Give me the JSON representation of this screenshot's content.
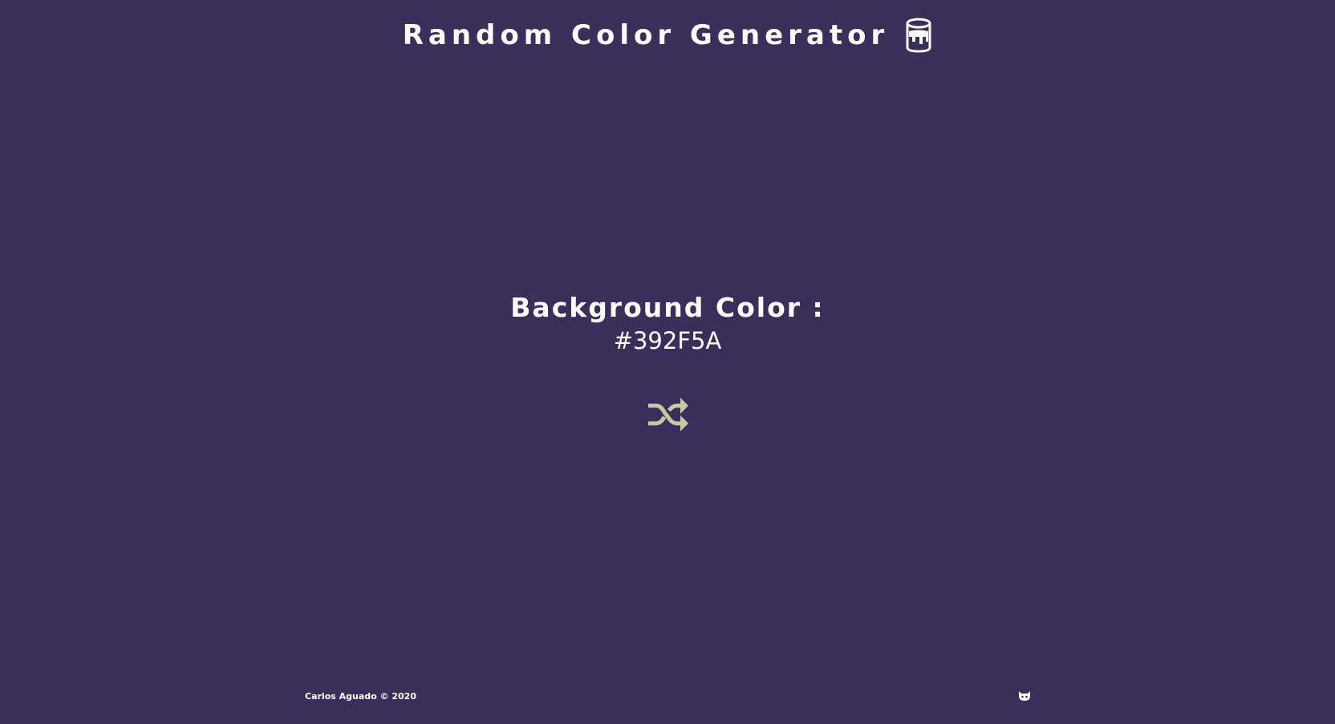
{
  "header": {
    "title": "Random Color Generator",
    "icon": "paint-bucket-icon"
  },
  "main": {
    "label": "Background Color :",
    "value": "#392F5A",
    "shuffle_icon": "shuffle-icon"
  },
  "footer": {
    "credit": "Carlos Aguado © 2020",
    "link_icon": "github-icon"
  },
  "colors": {
    "background": "#392F5A",
    "text": "#FFFFFF",
    "accent": "#C9C8A6"
  }
}
